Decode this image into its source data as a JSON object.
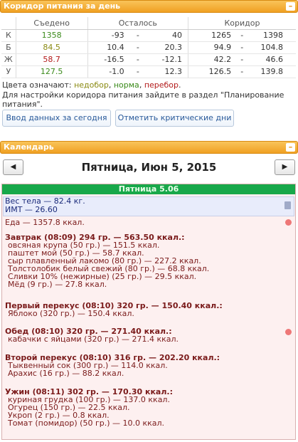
{
  "corridor_panel": {
    "title": "Коридор питания за день",
    "minimize": "–",
    "headers": {
      "eaten": "Съедено",
      "remaining": "Осталось",
      "corridor": "Коридор"
    },
    "rows": [
      {
        "label": "К",
        "eaten": "1358",
        "eaten_color": "#3a8a1a",
        "rem_a": "-93",
        "rem_b": "40",
        "cor_a": "1265",
        "cor_b": "1398",
        "dash": "-"
      },
      {
        "label": "Б",
        "eaten": "84.5",
        "eaten_color": "#8a8a12",
        "rem_a": "10.4",
        "rem_b": "20.3",
        "cor_a": "94.9",
        "cor_b": "104.8",
        "dash": "-"
      },
      {
        "label": "Ж",
        "eaten": "58.7",
        "eaten_color": "#b21a1a",
        "rem_a": "-16.5",
        "rem_b": "-12.1",
        "cor_a": "42.2",
        "cor_b": "46.6",
        "dash": "-"
      },
      {
        "label": "У",
        "eaten": "127.5",
        "eaten_color": "#3a8a1a",
        "rem_a": "-1.0",
        "rem_b": "12.3",
        "cor_a": "126.5",
        "cor_b": "139.8",
        "dash": "-"
      }
    ],
    "legend_prefix": "Цвета означают:",
    "legend_under": "недобор",
    "legend_norm": "норма",
    "legend_over": "перебор",
    "legend_sep": ",",
    "legend_end": ".",
    "note": "Для настройки коридора питания зайдите в раздел \"Планирование питания\".",
    "btn_enter": "Ввод данных за сегодня",
    "btn_critical": "Отметить критические дни"
  },
  "calendar_panel": {
    "title": "Календарь",
    "minimize": "–",
    "date_title": "Пятница, Июн 5, 2015",
    "prev": "◀",
    "next": "▶",
    "day_header": "Пятница 5.06",
    "weight_line": "Вес тела — 82.4 кг.",
    "bmi_line": "ИМТ — 26.60",
    "food_line": "Еда — 1357.8 ккал.",
    "meals": [
      {
        "title": "Завтрак (08:09) 294 гр. — 563.50 ккал.:",
        "items": [
          "овсяная крупа (50 гр.) — 151.5 ккал.",
          "паштет мой (50 гр.) — 58.7 ккал.",
          "сыр плавленный лакомо (80 гр.) — 227.2 ккал.",
          "Толстолобик белый свежий (80 гр.) — 68.8 ккал.",
          "Сливки 10% (нежирные) (25 гр.) — 29.5 ккал.",
          "Мёд (9 гр.) — 27.8 ккал."
        ]
      },
      {
        "title": "Первый перекус (08:10) 320 гр. — 150.40 ккал.:",
        "items": [
          "Яблоко (320 гр.) — 150.4 ккал."
        ]
      },
      {
        "title": "Обед (08:10) 320 гр. — 271.40 ккал.:",
        "items": [
          "кабачки с яйцами (320 гр.) — 271.4 ккал."
        ]
      },
      {
        "title": "Второй перекус (08:10) 316 гр. — 202.20 ккал.:",
        "items": [
          "Тыквенный сок (300 гр.) — 114.0 ккал.",
          "Арахис (16 гр.) — 88.2 ккал."
        ]
      },
      {
        "title": "Ужин (08:11) 302 гр. — 170.30 ккал.:",
        "items": [
          "куриная грудка (100 гр.) — 137.0 ккал.",
          "Огурец (150 гр.) — 22.5 ккал.",
          "Укроп (2 гр.) — 0.8 ккал.",
          "Томат (помидор) (50 гр.) — 10.0 ккал."
        ]
      }
    ]
  }
}
